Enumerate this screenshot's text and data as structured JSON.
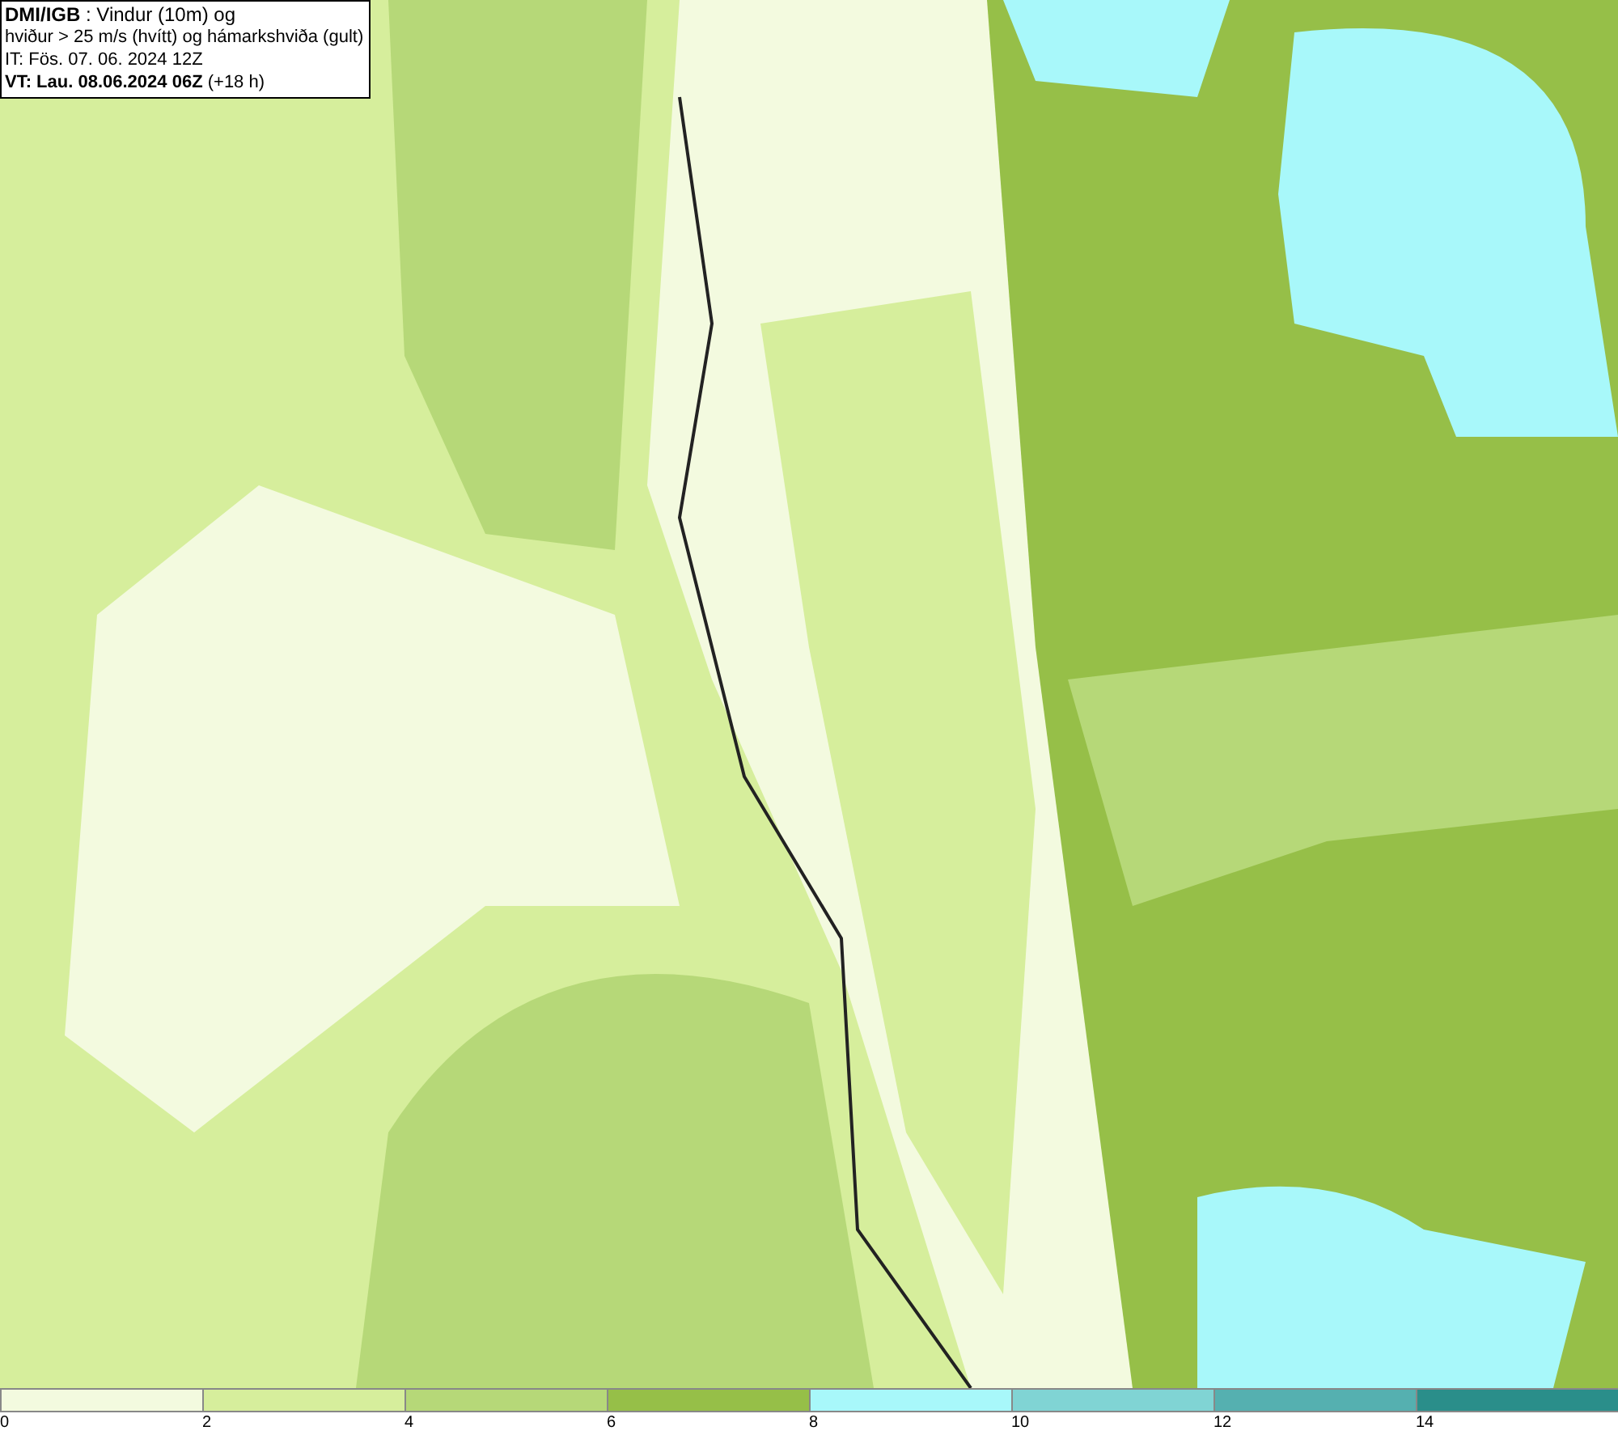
{
  "title_box": {
    "lines": [
      "**DMI/IGB** : Vindur (10m) og",
      "hviður > 25 m/s (hvítt) og hámarkshviða (gult)",
      "IT: Fös. 07. 06. 2024 12Z",
      "**VT: Lau. 08.06.2024 06Z** (+18 h)"
    ]
  },
  "legend": {
    "bins": [
      {
        "label": "0",
        "color": "#f3fadf"
      },
      {
        "label": "2",
        "color": "#d6ee9c"
      },
      {
        "label": "4",
        "color": "#b6d878"
      },
      {
        "label": "6",
        "color": "#96bf48"
      },
      {
        "label": "8",
        "color": "#a8f8fa"
      },
      {
        "label": "10",
        "color": "#80d4d4"
      },
      {
        "label": "12",
        "color": "#55b0b0"
      },
      {
        "label": "14",
        "color": "#2a8e8a"
      }
    ]
  }
}
